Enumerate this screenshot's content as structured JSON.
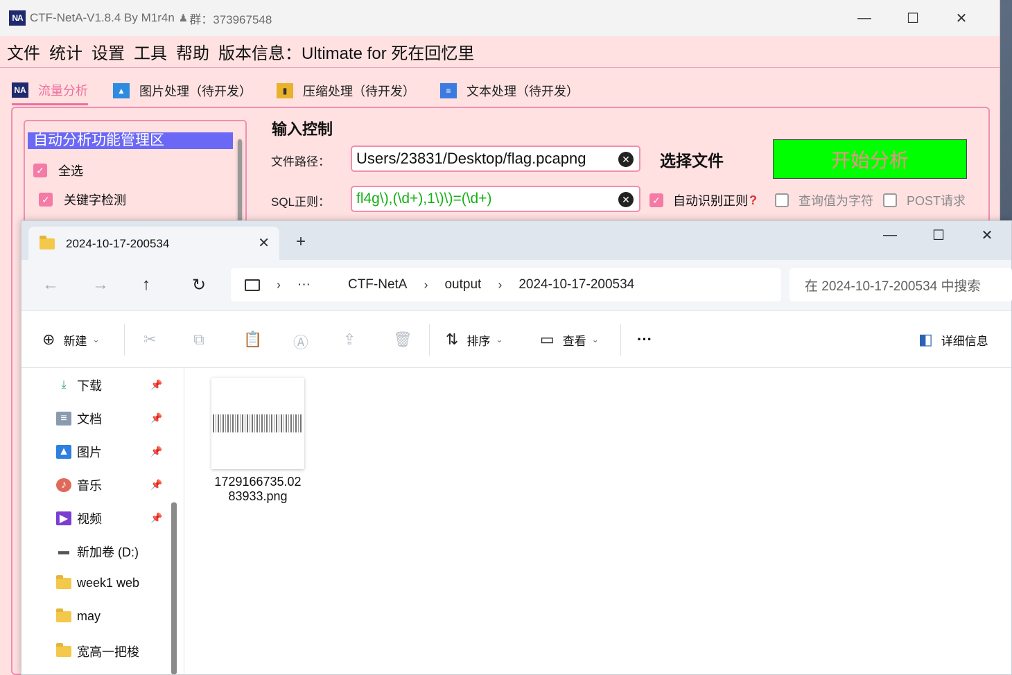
{
  "neta": {
    "title": "CTF-NetA-V1.8.4 By M1r4n",
    "qq_group": "群：373967548",
    "logo_text": "NA",
    "menu": [
      "文件",
      "统计",
      "设置",
      "工具",
      "帮助",
      "版本信息：Ultimate for 死在回忆里"
    ],
    "tabs": [
      {
        "label": "流量分析",
        "icon": "na-logo-icon",
        "active": true
      },
      {
        "label": "图片处理（待开发）",
        "icon": "image-icon",
        "active": false
      },
      {
        "label": "压缩处理（待开发）",
        "icon": "archive-icon",
        "active": false
      },
      {
        "label": "文本处理（待开发）",
        "icon": "text-doc-icon",
        "active": false
      }
    ],
    "func_area": {
      "header": "自动分析功能管理区",
      "items": [
        {
          "label": "全选",
          "checked": true
        },
        {
          "label": "关键字检测",
          "checked": true
        }
      ]
    },
    "input_control": {
      "title": "输入控制",
      "file_path_label": "文件路径：",
      "file_path_value": "Users/23831/Desktop/flag.pcapng",
      "select_file": "选择文件",
      "start_button": "开始分析",
      "sql_label": "SQL正则：",
      "sql_value": "fl4g\\),(\\d+),1\\)\\)=(\\d+)",
      "options": [
        {
          "label": "自动识别正则",
          "checked": true,
          "help": "?"
        },
        {
          "label": "查询值为字符",
          "checked": false
        },
        {
          "label": "POST请求",
          "checked": false
        }
      ]
    },
    "colors": {
      "accent": "#f47ba5",
      "header": "#6b68f5",
      "start": "#00ff00",
      "bg": "#ffe1e1"
    }
  },
  "explorer": {
    "tab_title": "2024-10-17-200534",
    "new_tab": "+",
    "breadcrumb": [
      "···",
      "CTF-NetA",
      "output",
      "2024-10-17-200534"
    ],
    "search_placeholder": "在 2024-10-17-200534 中搜索",
    "toolbar": {
      "new": "新建",
      "sort": "排序",
      "view": "查看",
      "more": "···",
      "details": "详细信息"
    },
    "sidebar": [
      {
        "label": "下载",
        "icon": "download-icon",
        "pinned": true
      },
      {
        "label": "文档",
        "icon": "document-icon",
        "pinned": true
      },
      {
        "label": "图片",
        "icon": "pictures-icon",
        "pinned": true
      },
      {
        "label": "音乐",
        "icon": "music-icon",
        "pinned": true
      },
      {
        "label": "视频",
        "icon": "video-icon",
        "pinned": true
      },
      {
        "label": "新加卷 (D:)",
        "icon": "drive-icon",
        "pinned": false
      },
      {
        "label": "week1 web",
        "icon": "folder-icon",
        "pinned": false
      },
      {
        "label": "may",
        "icon": "folder-icon",
        "pinned": false
      },
      {
        "label": "宽高一把梭",
        "icon": "folder-icon",
        "pinned": false
      }
    ],
    "files": [
      {
        "name_line1": "1729166735.02",
        "name_line2": "83933.png"
      }
    ]
  }
}
